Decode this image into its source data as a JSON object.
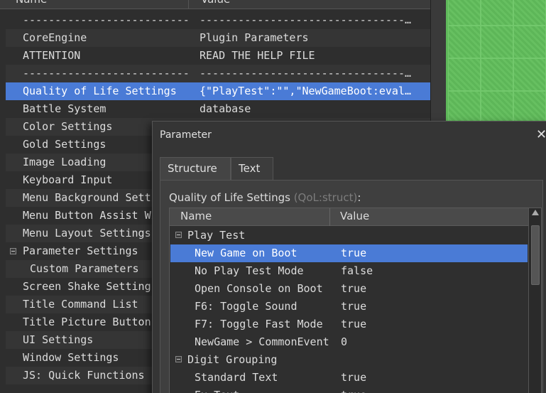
{
  "plugin_list": {
    "header": {
      "name": "Name",
      "value": "Value"
    },
    "rows": [
      {
        "name": "--------------------------",
        "value": "-----------------------------------------"
      },
      {
        "name": "CoreEngine",
        "value": "Plugin Parameters"
      },
      {
        "name": "ATTENTION",
        "value": "READ THE HELP FILE"
      },
      {
        "name": "--------------------------",
        "value": "-----------------------------------------"
      },
      {
        "name": "Quality of Life Settings",
        "value": "{\"PlayTest\":\"\",\"NewGameBoot:eval…"
      },
      {
        "name": "Battle System",
        "value": "database"
      },
      {
        "name": "Color Settings",
        "value": ""
      },
      {
        "name": "Gold Settings",
        "value": ""
      },
      {
        "name": "Image Loading",
        "value": ""
      },
      {
        "name": "Keyboard Input",
        "value": ""
      },
      {
        "name": "Menu Background Setti",
        "value": ""
      },
      {
        "name": "Menu Button Assist Wi",
        "value": ""
      },
      {
        "name": "Menu Layout Settings",
        "value": ""
      },
      {
        "name": "Parameter Settings",
        "value": ""
      },
      {
        "name": "Custom Parameters",
        "value": ""
      },
      {
        "name": "Screen Shake Settings",
        "value": ""
      },
      {
        "name": "Title Command List",
        "value": ""
      },
      {
        "name": "Title Picture Buttons",
        "value": ""
      },
      {
        "name": "UI Settings",
        "value": ""
      },
      {
        "name": "Window Settings",
        "value": ""
      },
      {
        "name": "JS: Quick Functions",
        "value": ""
      }
    ]
  },
  "dialog": {
    "title": "Parameter",
    "close": "✕",
    "tabs": [
      "Structure",
      "Text"
    ],
    "struct_label_main": "Quality of Life Settings",
    "struct_label_type": "(QoL:struct)",
    "struct_label_colon": ":",
    "tree_header": {
      "name": "Name",
      "value": "Value"
    },
    "tree_rows": [
      {
        "name": "Play Test",
        "value": ""
      },
      {
        "name": "New Game on Boot",
        "value": "true"
      },
      {
        "name": "No Play Test Mode",
        "value": "false"
      },
      {
        "name": "Open Console on Boot",
        "value": "true"
      },
      {
        "name": "F6: Toggle Sound",
        "value": "true"
      },
      {
        "name": "F7: Toggle Fast Mode",
        "value": "true"
      },
      {
        "name": "NewGame > CommonEvent",
        "value": "0"
      },
      {
        "name": "Digit Grouping",
        "value": ""
      },
      {
        "name": "Standard Text",
        "value": "true"
      },
      {
        "name": "Ex Text",
        "value": "true"
      }
    ]
  }
}
